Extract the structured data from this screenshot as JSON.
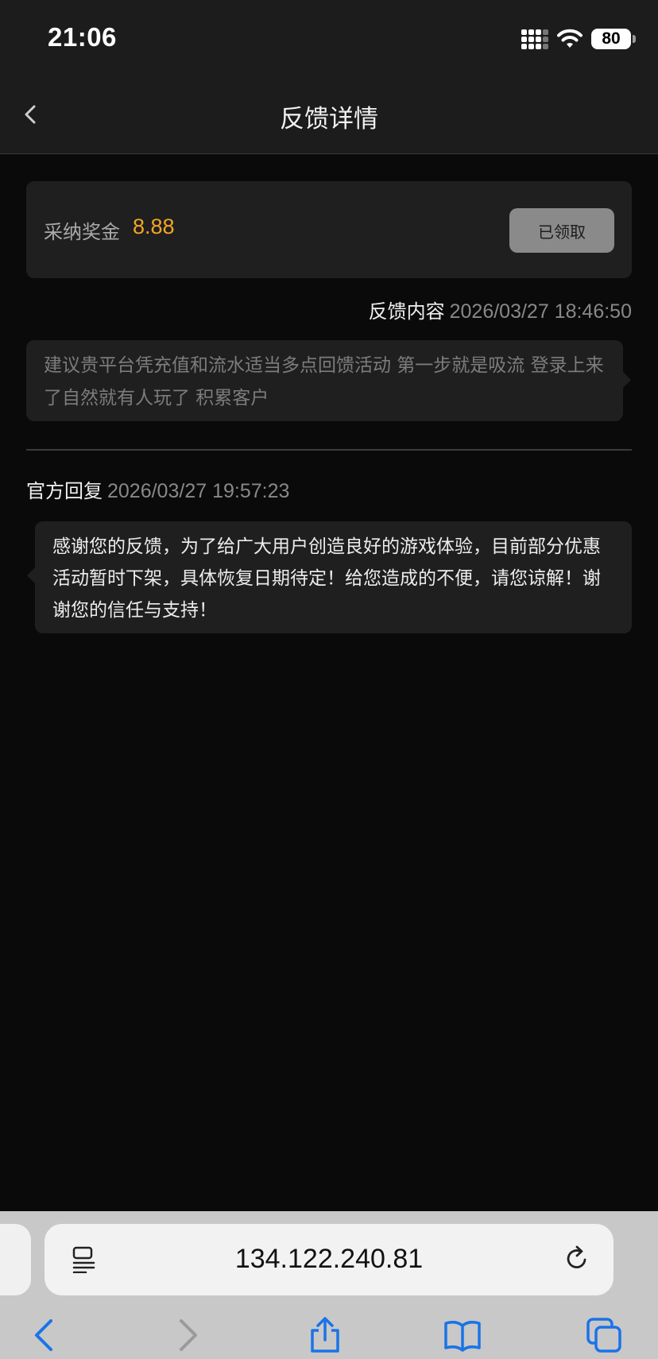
{
  "status_bar": {
    "time": "21:06",
    "battery": "80"
  },
  "nav": {
    "title": "反馈详情"
  },
  "reward": {
    "label": "采纳奖金",
    "amount": "8.88",
    "button_label": "已领取"
  },
  "feedback": {
    "title": "反馈内容",
    "time": "2026/03/27 18:46:50",
    "content": "建议贵平台凭充值和流水适当多点回馈活动 第一步就是吸流 登录上来了自然就有人玩了 积累客户"
  },
  "reply": {
    "title": "官方回复",
    "time": "2026/03/27 19:57:23",
    "content": "感谢您的反馈，为了给广大用户创造良好的游戏体验，目前部分优惠活动暂时下架，具体恢复日期待定！给您造成的不便，请您谅解！谢谢您的信任与支持！"
  },
  "browser": {
    "url": "134.122.240.81",
    "accent": "#1a73e8"
  }
}
